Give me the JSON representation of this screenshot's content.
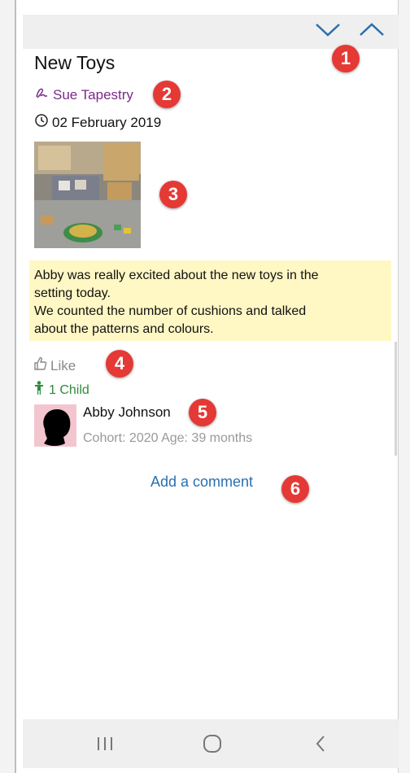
{
  "post": {
    "title": "New Toys",
    "author": "Sue Tapestry",
    "date": "02 February 2019",
    "note_line1": "Abby was really excited about the new toys in the",
    "note_line2": "setting today.",
    "note_line3": "We counted the number of cushions and talked",
    "note_line4": "about the patterns and colours."
  },
  "actions": {
    "like_label": "Like",
    "children_label": "1 Child",
    "add_comment_label": "Add a comment"
  },
  "child": {
    "name": "Abby Johnson",
    "meta": "Cohort: 2020 Age: 39 months"
  },
  "badges": {
    "b1": "1",
    "b2": "2",
    "b3": "3",
    "b4": "4",
    "b5": "5",
    "b6": "6"
  },
  "colors": {
    "accent_blue": "#2a6fb0",
    "author_purple": "#7b2a8a",
    "child_green": "#2e8b3a",
    "badge_red": "#e53935",
    "note_bg": "#fff7c4"
  },
  "icons": {
    "down": "chevron-down-icon",
    "up": "chevron-up-icon",
    "author": "pen-icon",
    "date": "clock-icon",
    "like": "thumbs-up-icon",
    "child": "child-figure-icon",
    "nav_recent": "recent-apps-icon",
    "nav_home": "home-icon",
    "nav_back": "back-icon"
  }
}
